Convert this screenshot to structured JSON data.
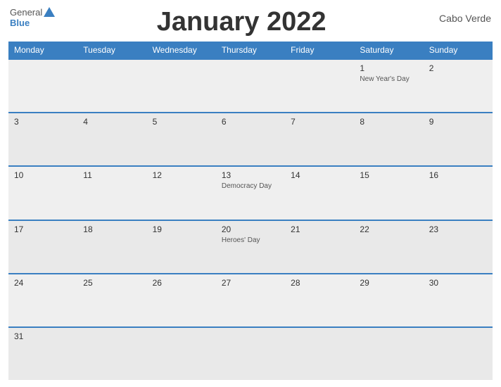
{
  "header": {
    "title": "January 2022",
    "country": "Cabo Verde",
    "logo": {
      "general": "General",
      "blue": "Blue"
    }
  },
  "days_of_week": [
    "Monday",
    "Tuesday",
    "Wednesday",
    "Thursday",
    "Friday",
    "Saturday",
    "Sunday"
  ],
  "weeks": [
    {
      "days": [
        {
          "num": "",
          "holiday": ""
        },
        {
          "num": "",
          "holiday": ""
        },
        {
          "num": "",
          "holiday": ""
        },
        {
          "num": "",
          "holiday": ""
        },
        {
          "num": "",
          "holiday": ""
        },
        {
          "num": "1",
          "holiday": "New Year's Day"
        },
        {
          "num": "2",
          "holiday": ""
        }
      ]
    },
    {
      "days": [
        {
          "num": "3",
          "holiday": ""
        },
        {
          "num": "4",
          "holiday": ""
        },
        {
          "num": "5",
          "holiday": ""
        },
        {
          "num": "6",
          "holiday": ""
        },
        {
          "num": "7",
          "holiday": ""
        },
        {
          "num": "8",
          "holiday": ""
        },
        {
          "num": "9",
          "holiday": ""
        }
      ]
    },
    {
      "days": [
        {
          "num": "10",
          "holiday": ""
        },
        {
          "num": "11",
          "holiday": ""
        },
        {
          "num": "12",
          "holiday": ""
        },
        {
          "num": "13",
          "holiday": "Democracy Day"
        },
        {
          "num": "14",
          "holiday": ""
        },
        {
          "num": "15",
          "holiday": ""
        },
        {
          "num": "16",
          "holiday": ""
        }
      ]
    },
    {
      "days": [
        {
          "num": "17",
          "holiday": ""
        },
        {
          "num": "18",
          "holiday": ""
        },
        {
          "num": "19",
          "holiday": ""
        },
        {
          "num": "20",
          "holiday": "Heroes' Day"
        },
        {
          "num": "21",
          "holiday": ""
        },
        {
          "num": "22",
          "holiday": ""
        },
        {
          "num": "23",
          "holiday": ""
        }
      ]
    },
    {
      "days": [
        {
          "num": "24",
          "holiday": ""
        },
        {
          "num": "25",
          "holiday": ""
        },
        {
          "num": "26",
          "holiday": ""
        },
        {
          "num": "27",
          "holiday": ""
        },
        {
          "num": "28",
          "holiday": ""
        },
        {
          "num": "29",
          "holiday": ""
        },
        {
          "num": "30",
          "holiday": ""
        }
      ]
    },
    {
      "days": [
        {
          "num": "31",
          "holiday": ""
        },
        {
          "num": "",
          "holiday": ""
        },
        {
          "num": "",
          "holiday": ""
        },
        {
          "num": "",
          "holiday": ""
        },
        {
          "num": "",
          "holiday": ""
        },
        {
          "num": "",
          "holiday": ""
        },
        {
          "num": "",
          "holiday": ""
        }
      ]
    }
  ]
}
